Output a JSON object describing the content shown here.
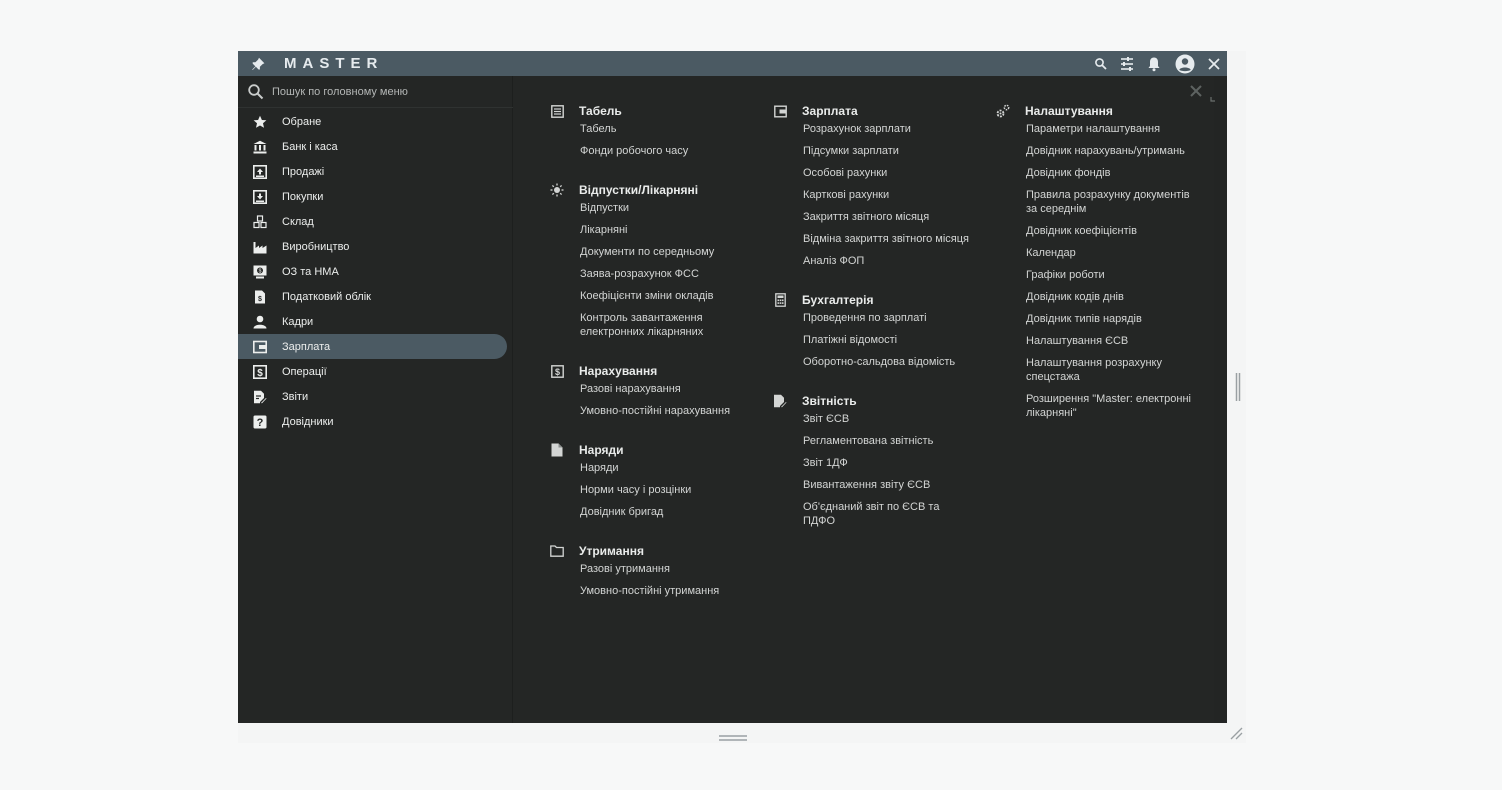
{
  "app": {
    "brand": "MASTER"
  },
  "titlebar": {
    "icons": [
      "pin-icon",
      "search-icon",
      "filter-settings-icon",
      "bell-icon",
      "account-icon",
      "close-icon"
    ]
  },
  "search": {
    "placeholder": "Пошук по головному меню"
  },
  "sidebar": {
    "items": [
      {
        "label": "Обране",
        "icon": "star-icon"
      },
      {
        "label": "Банк і каса",
        "icon": "bank-icon"
      },
      {
        "label": "Продажі",
        "icon": "sales-icon"
      },
      {
        "label": "Покупки",
        "icon": "purchases-icon"
      },
      {
        "label": "Склад",
        "icon": "warehouse-icon"
      },
      {
        "label": "Виробництво",
        "icon": "factory-icon"
      },
      {
        "label": "ОЗ та НМА",
        "icon": "assets-icon"
      },
      {
        "label": "Податковий облік",
        "icon": "tax-icon"
      },
      {
        "label": "Кадри",
        "icon": "person-icon"
      },
      {
        "label": "Зарплата",
        "icon": "wallet-icon",
        "active": true
      },
      {
        "label": "Операції",
        "icon": "dollar-icon"
      },
      {
        "label": "Звіти",
        "icon": "reports-icon"
      },
      {
        "label": "Довідники",
        "icon": "question-icon"
      }
    ]
  },
  "main": {
    "columns": [
      {
        "sections": [
          {
            "title": "Табель",
            "icon": "timesheet-icon",
            "links": [
              "Табель",
              "Фонди робочого часу"
            ]
          },
          {
            "title": "Відпустки/Лікарняні",
            "icon": "sun-icon",
            "links": [
              "Відпустки",
              "Лікарняні",
              "Документи по середньому",
              "Заява-розрахунок ФСС",
              "Коефіцієнти зміни окладів",
              "Контроль завантаження електронних лікарняних"
            ]
          },
          {
            "title": "Нарахування",
            "icon": "accrual-icon",
            "links": [
              "Разові нарахування",
              "Умовно-постійні нарахування"
            ]
          },
          {
            "title": "Наряди",
            "icon": "document-icon",
            "links": [
              "Наряди",
              "Норми часу і розцінки",
              "Довідник бригад"
            ]
          },
          {
            "title": "Утримання",
            "icon": "folder-icon",
            "links": [
              "Разові утримання",
              "Умовно-постійні утримання"
            ]
          }
        ]
      },
      {
        "sections": [
          {
            "title": "Зарплата",
            "icon": "wallet-icon",
            "links": [
              "Розрахунок зарплати",
              "Підсумки зарплати",
              "Особові рахунки",
              "Карткові рахунки",
              "Закриття звітного місяця",
              "Відміна закриття звітного місяця",
              "Аналіз ФОП"
            ]
          },
          {
            "title": "Бухгалтерія",
            "icon": "calculator-icon",
            "links": [
              "Проведення по зарплаті",
              "Платіжні відомості",
              "Оборотно-сальдова відомість"
            ]
          },
          {
            "title": "Звітність",
            "icon": "reports-icon",
            "links": [
              "Звіт ЄСВ",
              "Регламентована звітність",
              "Звіт 1ДФ",
              "Вивантаження звіту ЄСВ",
              "Об'єднаний звіт по ЄСВ та ПДФО"
            ]
          }
        ]
      },
      {
        "sections": [
          {
            "title": "Налаштування",
            "icon": "gears-icon",
            "links": [
              "Параметри налаштування",
              "Довідник нарахувань/утримань",
              "Довідник фондів",
              "Правила розрахунку документів за середнім",
              "Довідник коефіцієнтів",
              "Календар",
              "Графіки роботи",
              "Довідник кодів днів",
              "Довідник типів нарядів",
              "Налаштування ЄСВ",
              "Налаштування розрахунку спецстажа",
              "Розширення \"Master: електронні лікарняні\""
            ]
          }
        ]
      }
    ]
  }
}
